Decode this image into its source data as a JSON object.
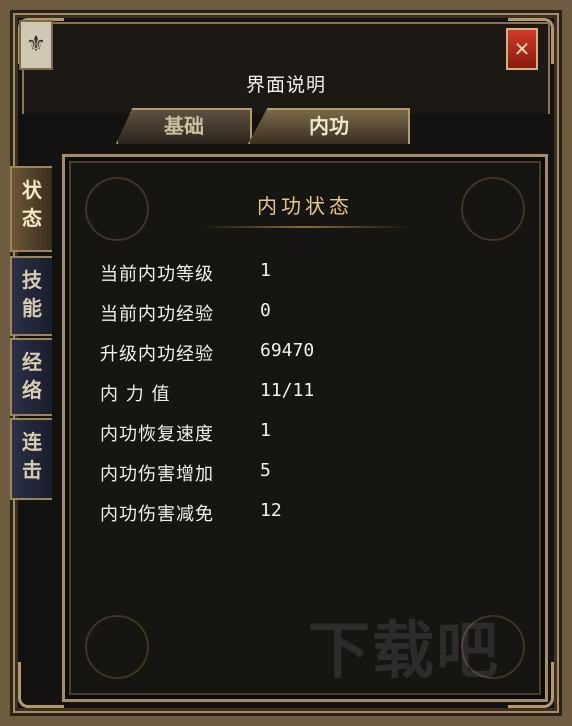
{
  "window": {
    "title": "界面说明",
    "close_icon": "✕",
    "emblem_glyph": "⚜"
  },
  "tabs": [
    {
      "label": "基础",
      "active": false
    },
    {
      "label": "内功",
      "active": true
    }
  ],
  "side_tabs": [
    {
      "label_top": "状",
      "label_bottom": "态",
      "active": true
    },
    {
      "label_top": "技",
      "label_bottom": "能",
      "active": false
    },
    {
      "label_top": "经",
      "label_bottom": "络",
      "active": false
    },
    {
      "label_top": "连",
      "label_bottom": "击",
      "active": false
    }
  ],
  "section": {
    "title": "内功状态"
  },
  "stats": [
    {
      "label": "当前内功等级",
      "value": "1"
    },
    {
      "label": "当前内功经验",
      "value": "0"
    },
    {
      "label": "升级内功经验",
      "value": "69470"
    },
    {
      "label": "内 力 值",
      "value": "11/11"
    },
    {
      "label": "内功恢复速度",
      "value": "1"
    },
    {
      "label": "内功伤害增加",
      "value": "5"
    },
    {
      "label": "内功伤害减免",
      "value": "12"
    }
  ],
  "watermark": {
    "text": "下载吧"
  },
  "colors": {
    "frame": "#a48d62",
    "title_text": "#f2f0e8",
    "section_title": "#e8c68a",
    "close_button": "#c0301f"
  }
}
